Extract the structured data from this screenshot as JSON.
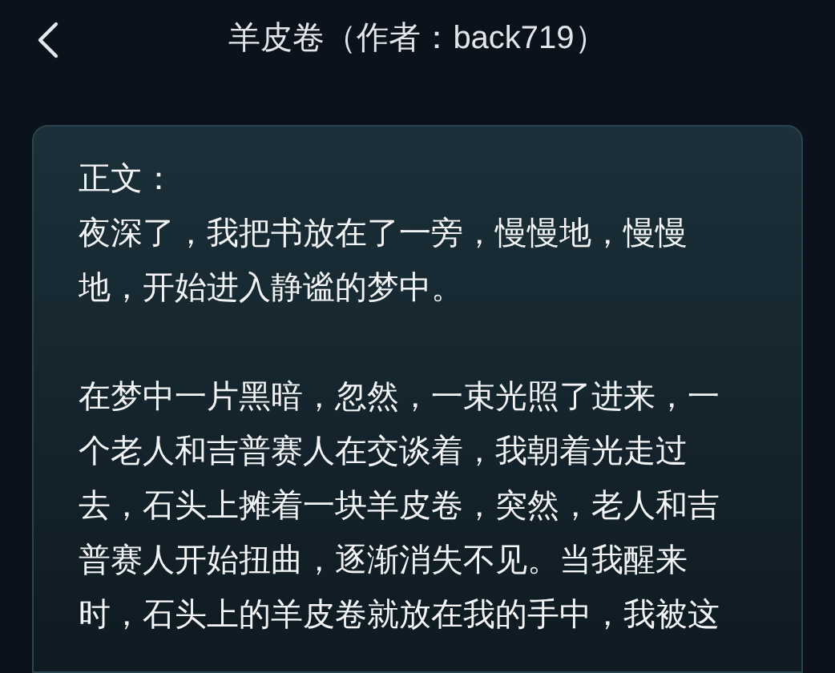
{
  "header": {
    "title": "羊皮卷（作者：back719）"
  },
  "article": {
    "label": "正文：",
    "paragraphs": [
      {
        "lines": [
          "夜深了，我把书放在了一旁，慢慢地，慢慢",
          "地，开始进入静谧的梦中。"
        ]
      },
      {
        "lines": [
          "在梦中一片黑暗，忽然，一束光照了进来，一",
          "个老人和吉普赛人在交谈着，我朝着光走过",
          "去，石头上摊着一块羊皮卷，突然，老人和吉",
          "普赛人开始扭曲，逐渐消失不见。当我醒来",
          "时，石头上的羊皮卷就放在我的手中，我被这"
        ]
      }
    ]
  }
}
